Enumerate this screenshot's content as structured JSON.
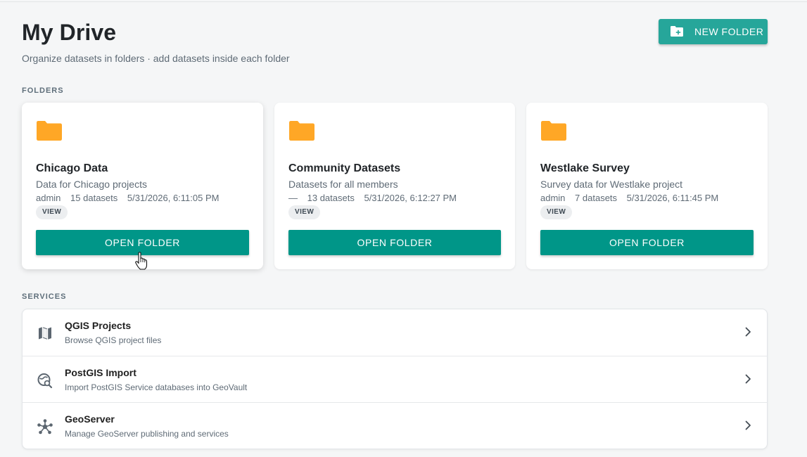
{
  "header": {
    "title": "My Drive",
    "subtitle": "Organize datasets in folders · add datasets inside each folder",
    "new_folder_label": "NEW FOLDER"
  },
  "sections": {
    "folders": "FOLDERS",
    "services": "SERVICES"
  },
  "folders": [
    {
      "name": "Chicago Data",
      "description": "Data for Chicago projects",
      "owner": "admin",
      "datasets": "15 datasets",
      "updated": "5/31/2026, 6:11:05 PM",
      "permission": "VIEW",
      "open_label": "OPEN FOLDER"
    },
    {
      "name": "Community Datasets",
      "description": "Datasets for all members",
      "owner": "—",
      "datasets": "13 datasets",
      "updated": "5/31/2026, 6:12:27 PM",
      "permission": "VIEW",
      "open_label": "OPEN FOLDER"
    },
    {
      "name": "Westlake Survey",
      "description": "Survey data for Westlake project",
      "owner": "admin",
      "datasets": "7 datasets",
      "updated": "5/31/2026, 6:11:45 PM",
      "permission": "VIEW",
      "open_label": "OPEN FOLDER"
    }
  ],
  "services": [
    {
      "icon": "map-icon",
      "title": "QGIS Projects",
      "subtitle": "Browse QGIS project files"
    },
    {
      "icon": "database-search-icon",
      "title": "PostGIS Import",
      "subtitle": "Import PostGIS Service databases into GeoVault"
    },
    {
      "icon": "network-hub-icon",
      "title": "GeoServer",
      "subtitle": "Manage GeoServer publishing and services"
    }
  ],
  "colors": {
    "accent": "#009688",
    "accent_light": "#26a69a",
    "folder": "#ffa726",
    "background": "#f5f6f7"
  }
}
